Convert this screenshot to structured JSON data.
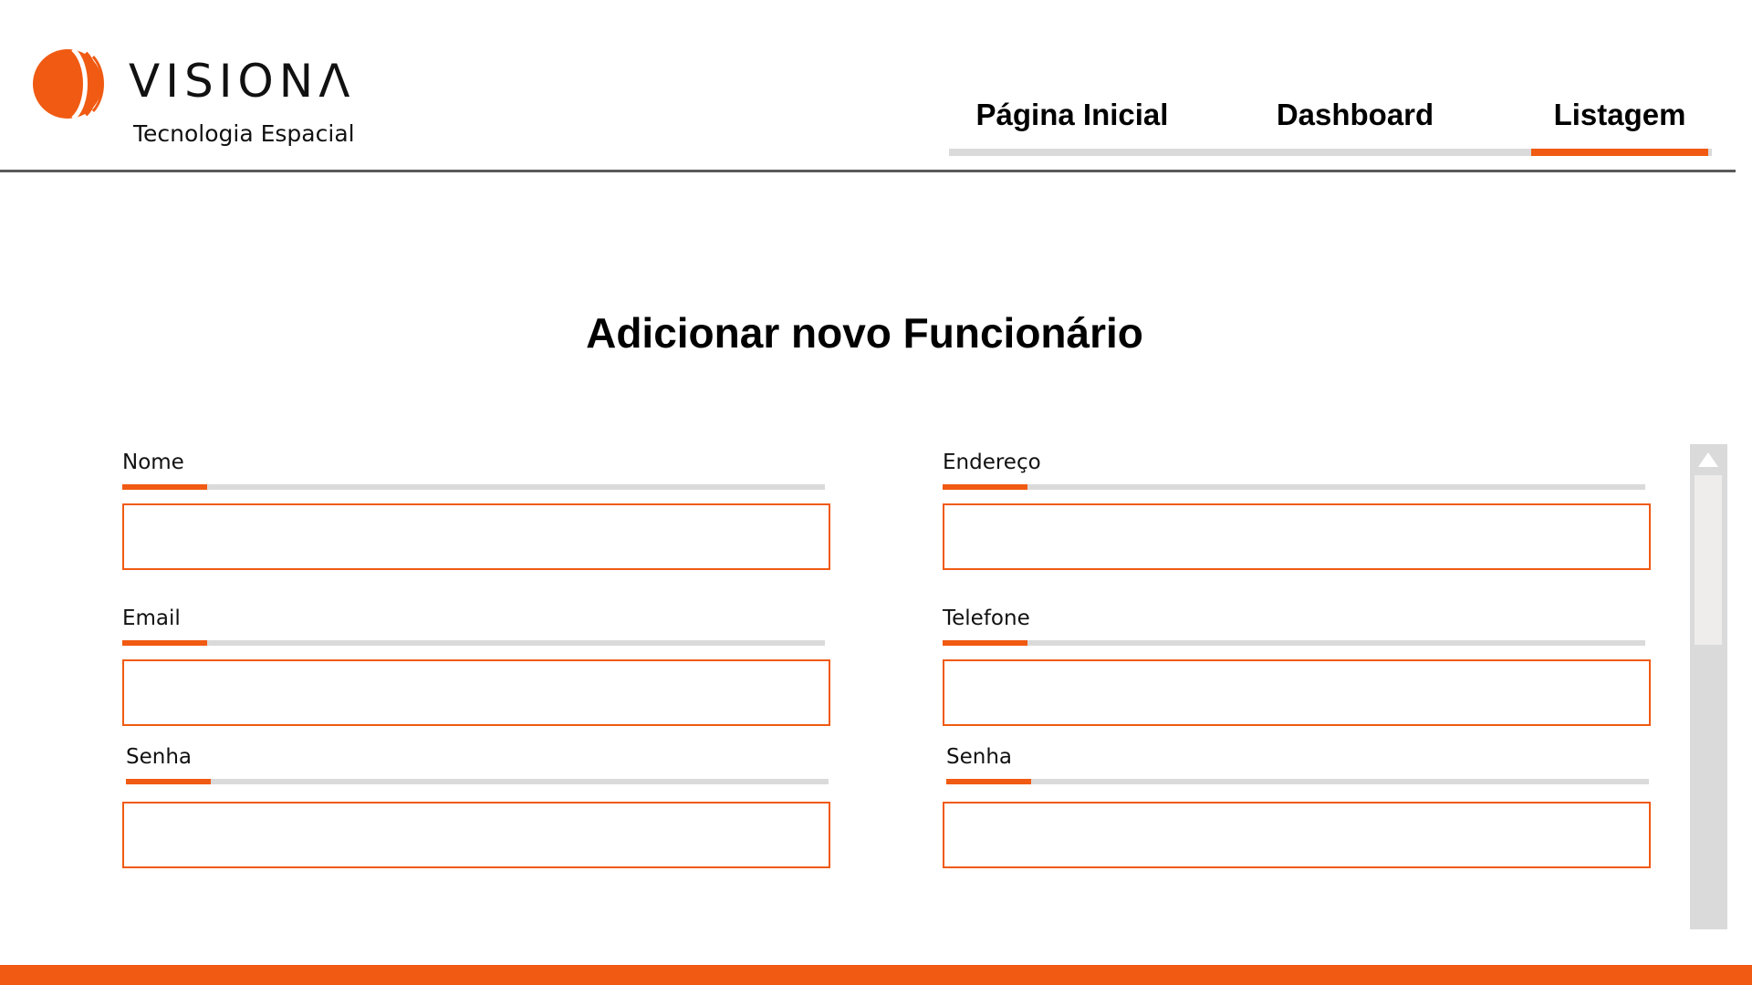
{
  "brand": {
    "name": "VISIONΛ",
    "tagline": "Tecnologia Espacial",
    "accent_color": "#f05a12"
  },
  "nav": {
    "items": [
      {
        "label": "Página Inicial",
        "active": false
      },
      {
        "label": "Dashboard",
        "active": false
      },
      {
        "label": "Listagem",
        "active": true
      }
    ]
  },
  "form": {
    "title": "Adicionar novo Funcionário",
    "fields": [
      {
        "label": "Nome",
        "value": ""
      },
      {
        "label": "Endereço",
        "value": ""
      },
      {
        "label": "Email",
        "value": ""
      },
      {
        "label": "Telefone",
        "value": ""
      },
      {
        "label": "Senha",
        "value": ""
      },
      {
        "label": "Senha",
        "value": ""
      }
    ]
  },
  "icons": {
    "scroll_up": "triangle-up-icon"
  }
}
